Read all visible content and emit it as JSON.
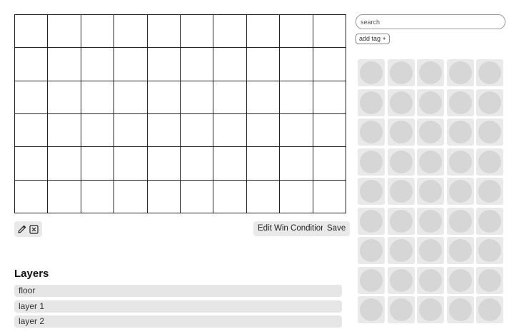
{
  "toolbar": {
    "tools": [
      {
        "icon": "pencil-icon"
      },
      {
        "icon": "close-box-icon"
      }
    ],
    "edit_win_condition_label": "Edit Win Condition",
    "save_label": "Save"
  },
  "layers": {
    "title": "Layers",
    "items": [
      {
        "label": "floor"
      },
      {
        "label": "layer 1"
      },
      {
        "label": "layer 2"
      }
    ]
  },
  "search": {
    "placeholder": "search"
  },
  "tags": {
    "add_label": "add tag +"
  },
  "board": {
    "columns": 10,
    "rows": 6
  },
  "palette": {
    "columns": 5,
    "rows": 9
  }
}
